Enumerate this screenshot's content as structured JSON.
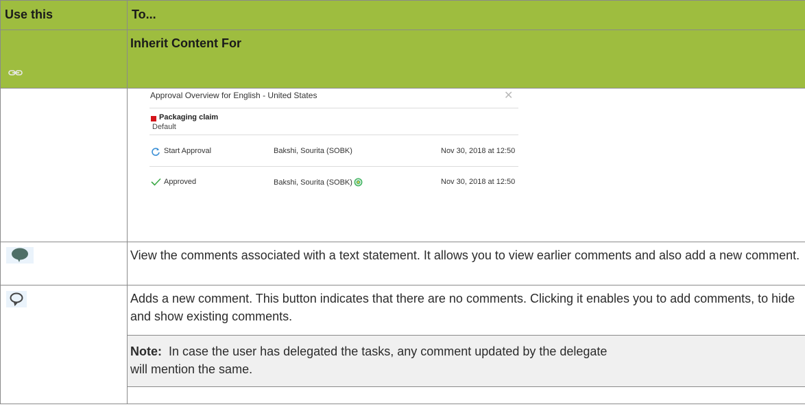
{
  "table": {
    "headers": {
      "use_this": "Use this",
      "to": "To..."
    },
    "rows": {
      "link": {
        "icon": "chain-link-icon",
        "title": "Inherit Content For"
      },
      "speech": {
        "icon": "filled-speech-bubble-icon",
        "text": "View the comments associated with a text statement. It allows you to view earlier comments and also add a new comment."
      },
      "new_comment": {
        "icon": "outline-speech-bubble-icon",
        "text": "Adds a new comment. This button indicates that there are no comments. Clicking it enables you to add comments, to hide and show existing comments.",
        "note_label": "Note:",
        "note_line1": "In case the user has delegated the tasks, any comment updated by the delegate",
        "note_line2": "will mention the same."
      }
    }
  },
  "approval_panel": {
    "title": "Approval Overview for English - United States",
    "close_icon": "close-icon",
    "claim_name": "Packaging claim",
    "claim_sub": "Default",
    "colors": {
      "claim_marker": "#d4141a",
      "refresh": "#3a8fd6",
      "check": "#3aa845"
    },
    "events": [
      {
        "icon": "refresh-icon",
        "action": "Start Approval",
        "user": "Bakshi, Sourita (SOBK)",
        "date": "Nov 30, 2018 at 12:50"
      },
      {
        "icon": "checkmark-icon",
        "action": "Approved",
        "user": "Bakshi, Sourita (SOBK)",
        "date": "Nov 30, 2018 at 12:50",
        "badge": "approved-badge-icon"
      }
    ]
  }
}
